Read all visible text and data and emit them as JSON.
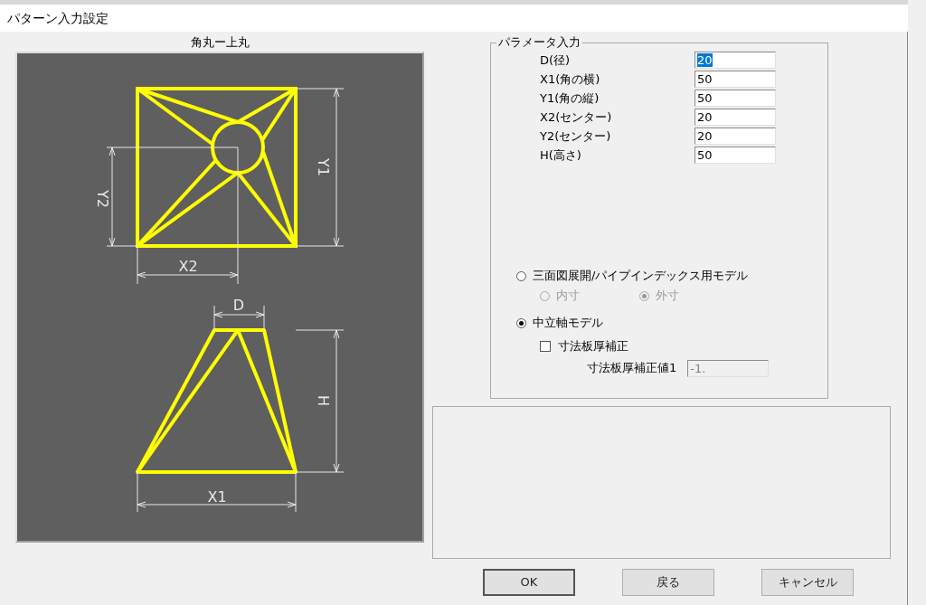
{
  "window": {
    "title": "パターン入力設定"
  },
  "preview": {
    "caption": "角丸ー上丸",
    "dimension_labels": [
      "Y1",
      "Y2",
      "X2",
      "D",
      "H",
      "X1"
    ]
  },
  "parameters": {
    "title": "パラメータ入力",
    "fields": [
      {
        "label": "D(径)",
        "value": "20",
        "selected": true
      },
      {
        "label": "X1(角の横)",
        "value": "50",
        "selected": false
      },
      {
        "label": "Y1(角の縦)",
        "value": "50",
        "selected": false
      },
      {
        "label": "X2(センター)",
        "value": "20",
        "selected": false
      },
      {
        "label": "Y2(センター)",
        "value": "20",
        "selected": false
      },
      {
        "label": "H(高さ)",
        "value": "50",
        "selected": false
      }
    ]
  },
  "models": [
    {
      "label": "三面図展開/パイプインデックス用モデル",
      "selected": false,
      "options": [
        {
          "label": "内寸",
          "selected": false,
          "disabled": true
        },
        {
          "label": "外寸",
          "selected": true,
          "disabled": true
        }
      ]
    },
    {
      "label": "中立軸モデル",
      "selected": true
    }
  ],
  "thickness_correction": {
    "label": "寸法板厚補正",
    "checked": false
  },
  "correction_value": {
    "label": "寸法板厚補正値1",
    "value": "-1.",
    "disabled": true
  },
  "buttons": [
    "OK",
    "戻る",
    "キャンセル"
  ]
}
